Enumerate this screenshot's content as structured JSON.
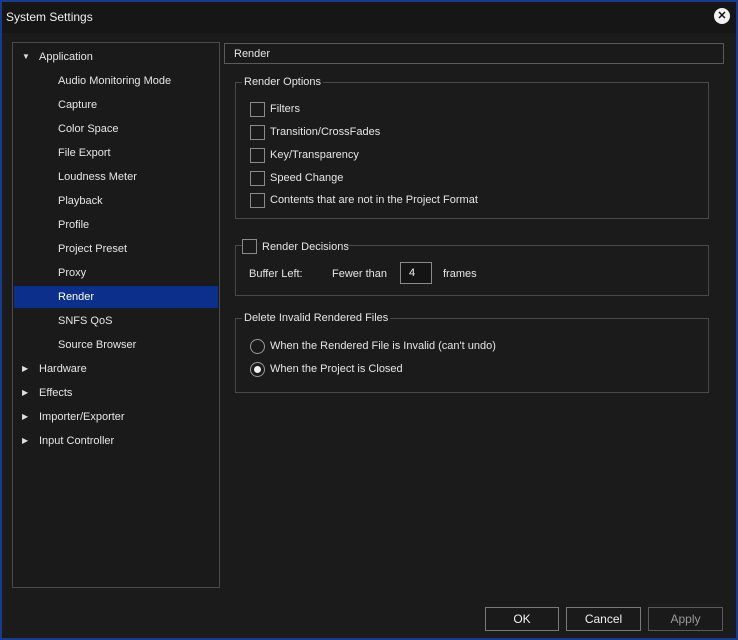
{
  "window": {
    "title": "System Settings"
  },
  "tree": {
    "items": [
      {
        "label": "Application",
        "expanded": true,
        "selected": false
      },
      {
        "label": "Audio Monitoring Mode",
        "selected": false
      },
      {
        "label": "Capture",
        "selected": false
      },
      {
        "label": "Color Space",
        "selected": false
      },
      {
        "label": "File Export",
        "selected": false
      },
      {
        "label": "Loudness Meter",
        "selected": false
      },
      {
        "label": "Playback",
        "selected": false
      },
      {
        "label": "Profile",
        "selected": false
      },
      {
        "label": "Project Preset",
        "selected": false
      },
      {
        "label": "Proxy",
        "selected": false
      },
      {
        "label": "Render",
        "selected": true
      },
      {
        "label": "SNFS QoS",
        "selected": false
      },
      {
        "label": "Source Browser",
        "selected": false
      },
      {
        "label": "Hardware",
        "expanded": false
      },
      {
        "label": "Effects",
        "expanded": false
      },
      {
        "label": "Importer/Exporter",
        "expanded": false
      },
      {
        "label": "Input Controller",
        "expanded": false
      }
    ]
  },
  "panel": {
    "header": "Render",
    "render_options": {
      "title": "Render Options",
      "items": [
        {
          "label": "Filters",
          "checked": false
        },
        {
          "label": "Transition/CrossFades",
          "checked": false
        },
        {
          "label": "Key/Transparency",
          "checked": false
        },
        {
          "label": "Speed Change",
          "checked": false
        },
        {
          "label": "Contents that are not in the Project Format",
          "checked": false
        }
      ]
    },
    "render_decisions": {
      "title": "Render Decisions",
      "checked": false,
      "buffer_left_label": "Buffer Left:",
      "fewer_than_label": "Fewer than",
      "frames_value": "4",
      "frames_label": "frames"
    },
    "delete_invalid": {
      "title": "Delete Invalid Rendered Files",
      "options": [
        {
          "label": "When the Rendered File is Invalid (can't undo)",
          "selected": false
        },
        {
          "label": "When the Project is Closed",
          "selected": true
        }
      ]
    }
  },
  "buttons": {
    "ok": "OK",
    "cancel": "Cancel",
    "apply": "Apply"
  }
}
